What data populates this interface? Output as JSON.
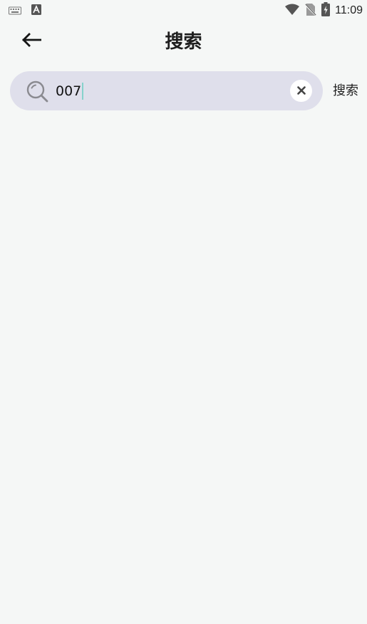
{
  "status_bar": {
    "time": "11:09",
    "left_icons": [
      "keyboard-icon",
      "a-badge-icon"
    ],
    "right_icons": [
      "wifi-icon",
      "no-sim-icon",
      "battery-charging-icon"
    ]
  },
  "header": {
    "title": "搜索",
    "back_icon": "arrow-left-icon"
  },
  "search": {
    "value": "007",
    "search_icon": "search-icon",
    "clear_icon": "close-icon",
    "button_label": "搜索"
  },
  "colors": {
    "background": "#f5f7f6",
    "search_box": "#dfdfeb",
    "caret": "#86d2cc"
  }
}
